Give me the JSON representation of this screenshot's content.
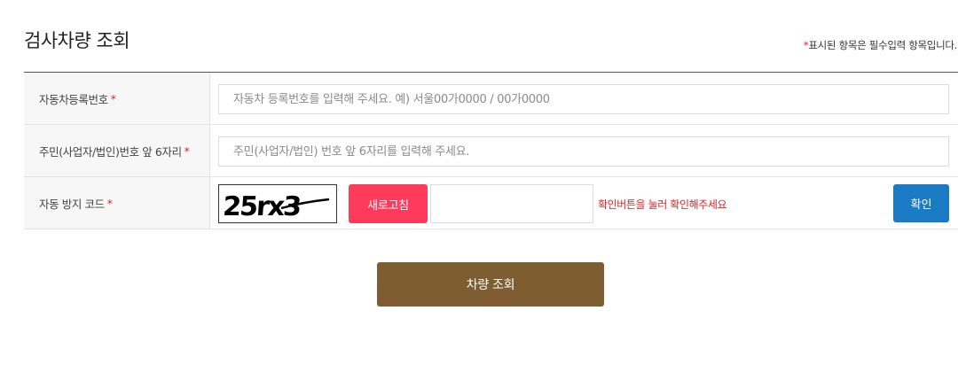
{
  "page": {
    "title": "검사차량 조회",
    "required_note_star": "*",
    "required_note": "표시된 항목은 필수입력 항목입니다."
  },
  "form": {
    "required_star": "*",
    "plate": {
      "label": "자동차등록번호",
      "placeholder": "자동차 등록번호를 입력해 주세요. 예) 서울00가0000 / 00가0000",
      "value": ""
    },
    "id_number": {
      "label": "주민(사업자/법인)번호 앞 6자리",
      "placeholder": "주민(사업자/법인) 번호 앞 6자리를 입력해 주세요.",
      "value": ""
    },
    "captcha": {
      "label": "자동 방지 코드",
      "image_text": "25rx3",
      "refresh_label": "새로고침",
      "input_value": "",
      "hint": "확인버튼을 눌러 확인해주세요",
      "confirm_label": "확인"
    }
  },
  "actions": {
    "search_label": "차량 조회"
  },
  "colors": {
    "required": "#e02424",
    "refresh_button": "#ff3b5c",
    "confirm_button": "#1a7bc4",
    "search_button": "#7e5e31"
  }
}
